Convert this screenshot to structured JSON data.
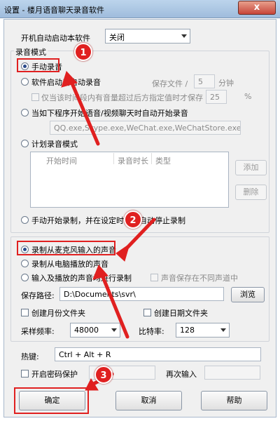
{
  "window": {
    "title": "设置 - 楼月语音聊天录音软件",
    "close_label": "x"
  },
  "autostart": {
    "label": "开机自动启动本软件",
    "value": "关闭"
  },
  "record_mode": {
    "group_label": "录音模式",
    "manual_label": "手动录音",
    "auto_on_start_label": "软件启动后自动录音",
    "save_file_label": "保存文件 /",
    "save_minutes": "5",
    "minutes_unit": "分钟",
    "threshold_label": "仅当该时间段内有音量超过后方指定值时才保存",
    "threshold_value": "25",
    "percent": "%",
    "on_app_label": "当如下程序开始语音/视频聊天时自动开始录音",
    "apps": "QQ.exe,Skype.exe,WeChat.exe,WeChatStore.exe,TIM.exe",
    "schedule_label": "计划录音模式",
    "table_headers": [
      "开始时间",
      "录音时长",
      "类型"
    ],
    "add_button": "添加",
    "delete_button": "删除",
    "manual_start_label": "手动开始录制，并在设定时间后自动停止录制"
  },
  "source": {
    "mic_label": "录制从麦克风输入的声音",
    "pc_label": "录制从电脑播放的声音",
    "both_label": "输入及播放的声音均进行录制",
    "separate_channel_label": "声音保存在不同声道中",
    "save_path_label": "保存路径:",
    "save_path_value": "D:\\Documents\\svr\\",
    "browse_button": "浏览",
    "monthly_folder_label": "创建月份文件夹",
    "daily_folder_label": "创建日期文件夹",
    "sample_rate_label": "采样频率:",
    "sample_rate_value": "48000",
    "bitrate_label": "比特率:",
    "bitrate_value": "128"
  },
  "hotkey": {
    "label": "热键:",
    "value": "Ctrl + Alt + R"
  },
  "password": {
    "enable_label": "开启密码保护",
    "confirm_label": "再次输入"
  },
  "buttons": {
    "ok": "确定",
    "cancel": "取消",
    "help": "帮助"
  },
  "annotations": {
    "step1": "1",
    "step2": "2",
    "step3": "3"
  },
  "colors": {
    "annotation_red": "#e02020",
    "title_bar": "#bcd4ec"
  }
}
